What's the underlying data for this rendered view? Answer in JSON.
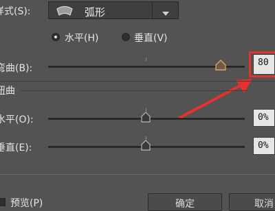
{
  "style": {
    "label": "样式(S):",
    "value": "弧形",
    "icon": "arc-shape-icon"
  },
  "orientation": {
    "options": [
      {
        "label": "水平(H)",
        "selected": true
      },
      {
        "label": "垂直(V)",
        "selected": false
      }
    ]
  },
  "bend": {
    "label": "弯曲(B):",
    "value": "80",
    "position_percent": 90
  },
  "distortion": {
    "section_label": "扭曲",
    "horizontal": {
      "label": "水平(O):",
      "value": "0%",
      "position_percent": 50
    },
    "vertical": {
      "label": "垂直(E):",
      "value": "0%",
      "position_percent": 50
    }
  },
  "footer": {
    "preview_label": "预览(P)",
    "ok_label": "确定",
    "cancel_label": "取消"
  },
  "annotation": {
    "color": "#e8302f"
  }
}
